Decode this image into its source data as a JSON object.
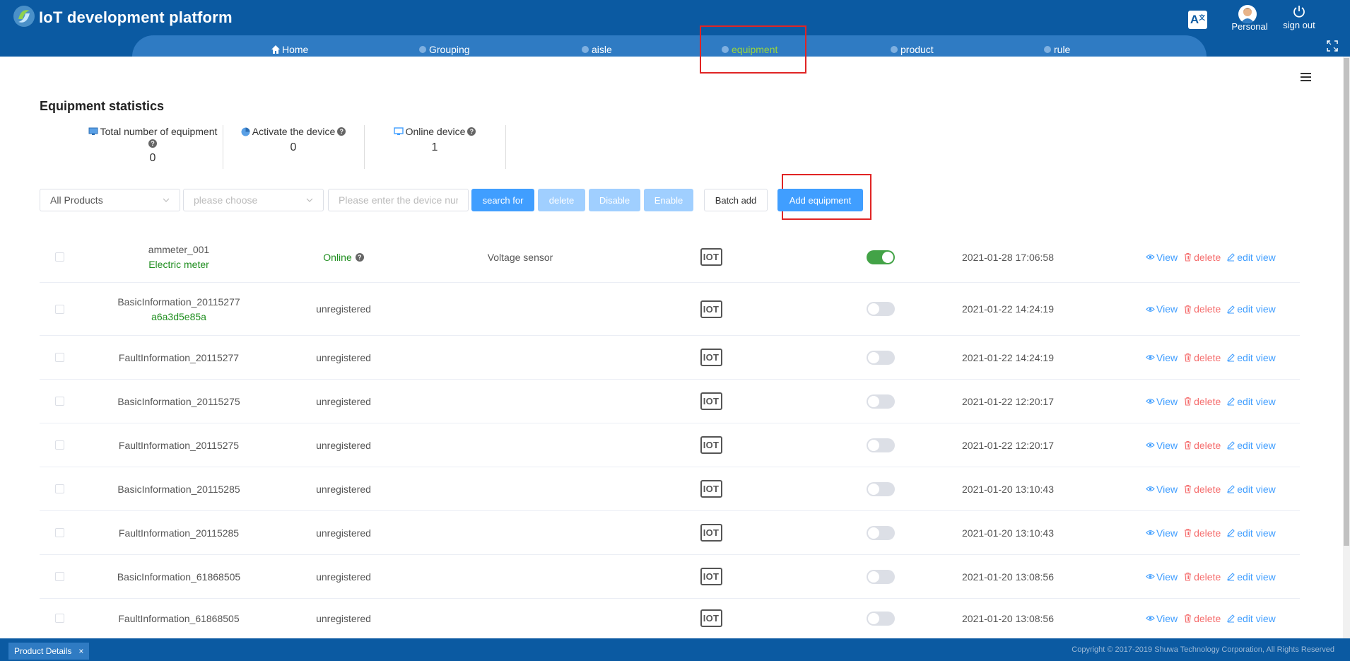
{
  "header": {
    "app_title": "IoT development platform",
    "personal_label": "Personal",
    "signout_label": "sign out",
    "lang_glyph": "A"
  },
  "nav": [
    {
      "label": "Home",
      "icon": "home-icon"
    },
    {
      "label": "Grouping",
      "icon": "grouping-icon"
    },
    {
      "label": "aisle",
      "icon": "aisle-icon"
    },
    {
      "label": "equipment",
      "icon": "equipment-icon",
      "active": true
    },
    {
      "label": "product",
      "icon": "product-icon"
    },
    {
      "label": "rule",
      "icon": "rule-icon"
    }
  ],
  "page": {
    "title": "Equipment statistics"
  },
  "stats": [
    {
      "label": "Total number of equipment",
      "value": "0",
      "icon": "monitor-icon"
    },
    {
      "label": "Activate the device",
      "value": "0",
      "icon": "pie-icon"
    },
    {
      "label": "Online device",
      "value": "1",
      "icon": "screen-icon"
    }
  ],
  "toolbar": {
    "product_select": "All Products",
    "choose_select_placeholder": "please choose",
    "device_search_placeholder": "Please enter the device nur",
    "search_label": "search for",
    "delete_label": "delete",
    "disable_label": "Disable",
    "enable_label": "Enable",
    "batch_add_label": "Batch add",
    "add_label": "Add equipment"
  },
  "devices": [
    {
      "name": "ammeter_001",
      "sub": "Electric meter",
      "status": "Online",
      "desc": "Voltage sensor",
      "enabled": true,
      "time": "2021-01-28 17:06:58"
    },
    {
      "name": "BasicInformation_20115277",
      "sub": "a6a3d5e85a",
      "status": "unregistered",
      "desc": "",
      "enabled": false,
      "time": "2021-01-22 14:24:19"
    },
    {
      "name": "FaultInformation_20115277",
      "sub": "",
      "status": "unregistered",
      "desc": "",
      "enabled": false,
      "time": "2021-01-22 14:24:19"
    },
    {
      "name": "BasicInformation_20115275",
      "sub": "",
      "status": "unregistered",
      "desc": "",
      "enabled": false,
      "time": "2021-01-22 12:20:17"
    },
    {
      "name": "FaultInformation_20115275",
      "sub": "",
      "status": "unregistered",
      "desc": "",
      "enabled": false,
      "time": "2021-01-22 12:20:17"
    },
    {
      "name": "BasicInformation_20115285",
      "sub": "",
      "status": "unregistered",
      "desc": "",
      "enabled": false,
      "time": "2021-01-20 13:10:43"
    },
    {
      "name": "FaultInformation_20115285",
      "sub": "",
      "status": "unregistered",
      "desc": "",
      "enabled": false,
      "time": "2021-01-20 13:10:43"
    },
    {
      "name": "BasicInformation_61868505",
      "sub": "",
      "status": "unregistered",
      "desc": "",
      "enabled": false,
      "time": "2021-01-20 13:08:56"
    },
    {
      "name": "FaultInformation_61868505",
      "sub": "",
      "status": "unregistered",
      "desc": "",
      "enabled": false,
      "time": "2021-01-20 13:08:56"
    }
  ],
  "row_actions": {
    "view": "View",
    "delete": "delete",
    "edit": "edit view"
  },
  "iot_badge": "IOT",
  "footer": {
    "tab_label": "Product Details",
    "tab_close": "×",
    "copyright": "Copyright © 2017-2019 Shuwa Technology Corporation, All Rights Reserved"
  },
  "colors": {
    "header_bg": "#0b5aa2",
    "nav_bg": "#2f7bc3",
    "active_nav": "#9bd63c",
    "primary": "#409eff",
    "danger": "#f56c6c",
    "online": "#1f8e1f",
    "highlight": "#e02424"
  }
}
